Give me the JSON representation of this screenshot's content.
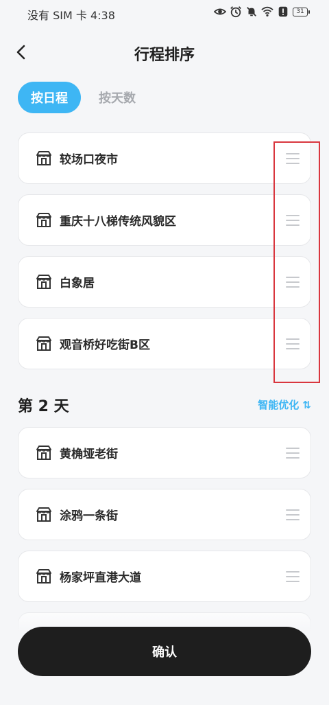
{
  "status_bar": {
    "carrier_time": "没有 SIM 卡 4:38",
    "battery": "31"
  },
  "header": {
    "title": "行程排序"
  },
  "tabs": [
    {
      "label": "按日程",
      "active": true
    },
    {
      "label": "按天数",
      "active": false
    }
  ],
  "day1_items": [
    {
      "name": "较场口夜市"
    },
    {
      "name": "重庆十八梯传统风貌区"
    },
    {
      "name": "白象居"
    },
    {
      "name": "观音桥好吃街B区"
    }
  ],
  "day2": {
    "title": "第 2 天",
    "smart_optimize": "智能优化 ⇅",
    "items": [
      {
        "name": "黄桷垭老街"
      },
      {
        "name": "涂鸦一条街"
      },
      {
        "name": "杨家坪直港大道"
      }
    ]
  },
  "confirm_label": "确认",
  "colors": {
    "accent": "#3eb6f4",
    "confirm_bg": "#1e1e1e",
    "highlight": "#d9363e"
  },
  "icons": {
    "poi": "storefront-icon",
    "drag": "drag-handle-icon"
  }
}
